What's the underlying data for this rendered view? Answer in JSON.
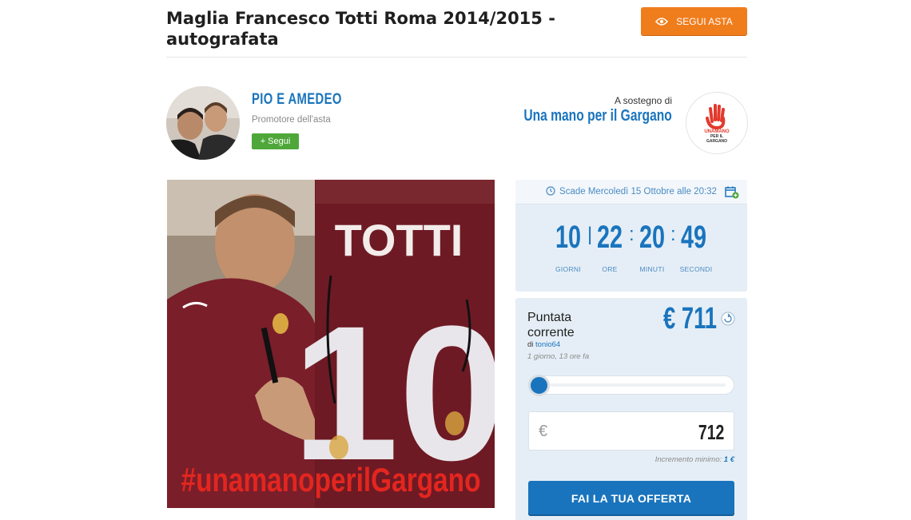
{
  "header": {
    "title": "Maglia Francesco Totti Roma 2014/2015 - autografata",
    "follow_auction_label": "SEGUI ASTA",
    "follow_icon": "eye-icon"
  },
  "promoter": {
    "name": "PIO E AMEDEO",
    "role": "Promotore dell'asta",
    "follow_label": "+ Segui"
  },
  "support": {
    "label": "A sostegno di",
    "charity": "Una mano per il Gargano",
    "logo_text": [
      "UNAMANO",
      "PER IL",
      "GARGANO"
    ]
  },
  "photo": {
    "jersey_name": "TOTTI",
    "jersey_number": "10",
    "hashtag": "#unamanoperilGargano"
  },
  "timer": {
    "expires": "Scade Mercoledì 15 Ottobre alle 20:32",
    "days": "10",
    "hours": "22",
    "minutes": "20",
    "seconds": "49",
    "labels": {
      "days": "GIORNI",
      "hours": "ORE",
      "minutes": "MINUTI",
      "seconds": "SECONDI"
    }
  },
  "bid": {
    "label": "Puntata corrente",
    "by_prefix": "di",
    "bidder": "tonio64",
    "ago": "1 giorno, 13 ore fa",
    "amount": "€ 711",
    "slider_position": 0,
    "currency_symbol": "€",
    "offer_value": "712",
    "increment_label": "Incremento minimo:",
    "increment_value": "1 €",
    "submit_label": "FAI LA TUA OFFERTA"
  },
  "colors": {
    "accent_blue": "#1a74bd",
    "orange": "#f07d1c",
    "green": "#4fa73a",
    "panel_bg": "#e5eef6"
  }
}
